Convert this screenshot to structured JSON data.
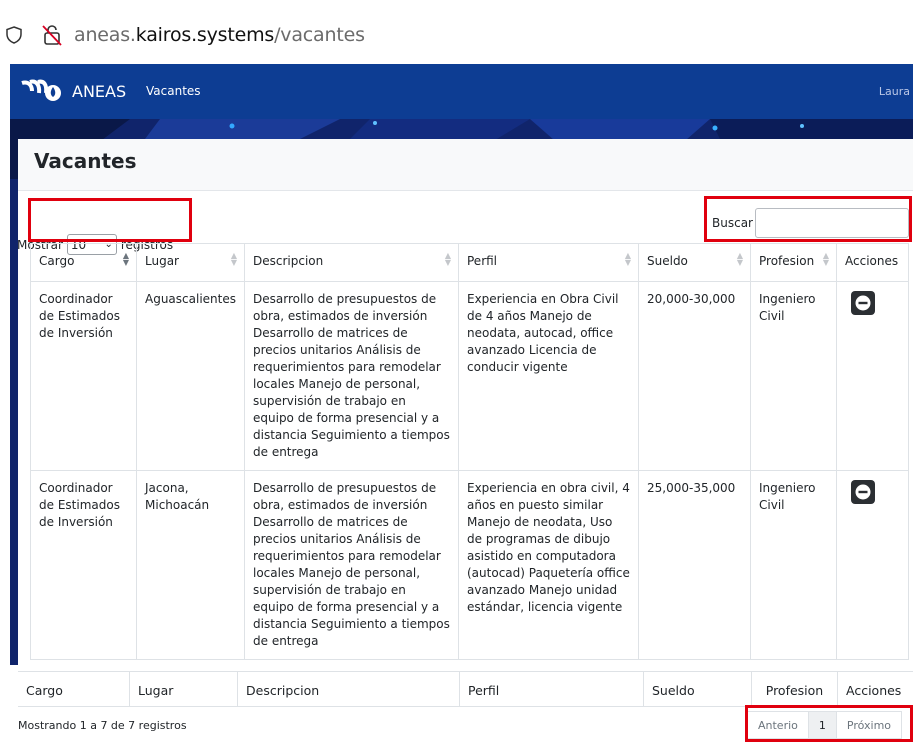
{
  "browser": {
    "url_subdomain": "aneas.",
    "url_domain": "kairos.systems",
    "url_path": "/vacantes"
  },
  "navbar": {
    "brand": "ANEAS",
    "link": "Vacantes",
    "user": "Laura ▾"
  },
  "card": {
    "title": "Vacantes"
  },
  "length_control": {
    "prefix": "Mostrar",
    "value": "10",
    "suffix": "registros"
  },
  "search": {
    "label": "Buscar",
    "value": ""
  },
  "table": {
    "columns": [
      "Cargo",
      "Lugar",
      "Descripcion",
      "Perfil",
      "Sueldo",
      "Profesion",
      "Acciones"
    ],
    "rows": [
      {
        "cargo": "Coordinador de Estimados de Inversión",
        "lugar": "Aguascalientes",
        "descripcion": "Desarrollo de presupuestos de obra, estimados de inversión Desarrollo de matrices de precios unitarios Análisis de requerimientos para remodelar locales Manejo de personal, supervisión de trabajo en equipo de forma presencial y a distancia Seguimiento a tiempos de entrega",
        "perfil": "Experiencia en Obra Civil de 4 años Manejo de neodata, autocad, office avanzado Licencia de conducir vigente",
        "sueldo": "20,000-30,000",
        "profesion": "Ingeniero Civil"
      },
      {
        "cargo": "Coordinador de Estimados de Inversión",
        "lugar": "Jacona, Michoacán",
        "descripcion": "Desarrollo de presupuestos de obra, estimados de inversión Desarrollo de matrices de precios unitarios Análisis de requerimientos para remodelar locales Manejo de personal, supervisión de trabajo en equipo de forma presencial y a distancia Seguimiento a tiempos de entrega",
        "perfil": "Experiencia en obra civil, 4 años en puesto similar Manejo de neodata, Uso de programas de dibujo asistido en computadora (autocad) Paquetería office avanzado Manejo unidad estándar, licencia vigente",
        "sueldo": "25,000-35,000",
        "profesion": "Ingeniero Civil"
      }
    ]
  },
  "footer": {
    "info": "Mostrando 1 a 7 de 7 registros",
    "pagination": {
      "previous": "Anterio",
      "current": "1",
      "next": "Próximo"
    }
  }
}
